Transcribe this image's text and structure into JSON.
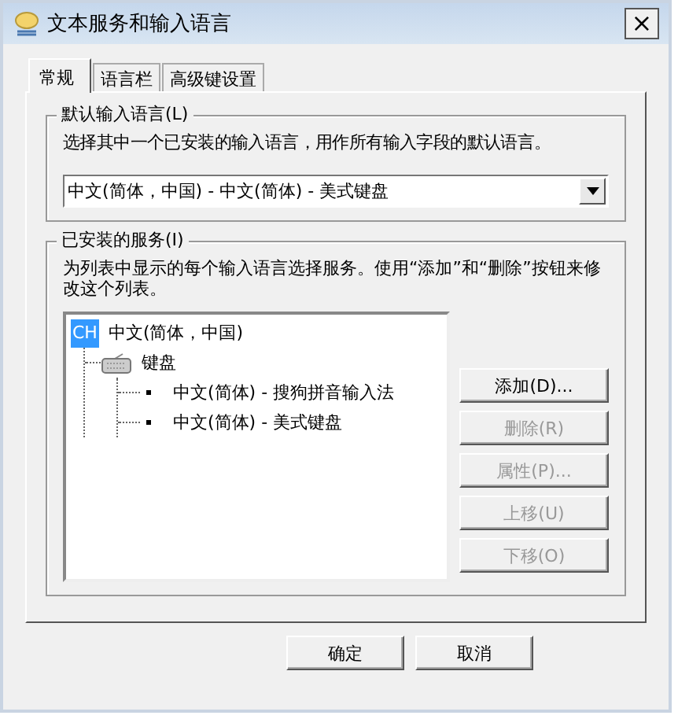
{
  "window": {
    "title": "文本服务和输入语言",
    "close": "×"
  },
  "tabs": [
    {
      "label": "常规",
      "selected": true
    },
    {
      "label": "语言栏",
      "selected": false
    },
    {
      "label": "高级键设置",
      "selected": false
    }
  ],
  "default_language": {
    "title": "默认输入语言(L)",
    "description": "选择其中一个已安装的输入语言，用作所有输入字段的默认语言。",
    "dropdown": {
      "value": "中文(简体，中国) - 中文(简体) - 美式键盘"
    }
  },
  "installed_services": {
    "title": "已安装的服务(I)",
    "description": "为列表中显示的每个输入语言选择服务。使用“添加”和“删除”按钮来修改这个列表。",
    "tree": [
      {
        "kind": "language",
        "badge": "CH",
        "label": "中文(简体，中国)",
        "selected": true,
        "children": [
          {
            "kind": "category",
            "label": "键盘",
            "selected": false,
            "children": [
              {
                "kind": "service",
                "label": "中文(简体) - 搜狗拼音输入法",
                "selected": false
              },
              {
                "kind": "service",
                "label": "中文(简体) - 美式键盘",
                "selected": false
              }
            ]
          }
        ]
      }
    ],
    "buttons": [
      {
        "label": "添加(D)...",
        "disabled": false
      },
      {
        "label": "删除(R)",
        "disabled": true
      },
      {
        "label": "属性(P)...",
        "disabled": true
      },
      {
        "label": "上移(U)",
        "disabled": true
      },
      {
        "label": "下移(O)",
        "disabled": true
      }
    ]
  },
  "dialog_buttons": [
    {
      "label": "确定"
    },
    {
      "label": "取消"
    }
  ]
}
